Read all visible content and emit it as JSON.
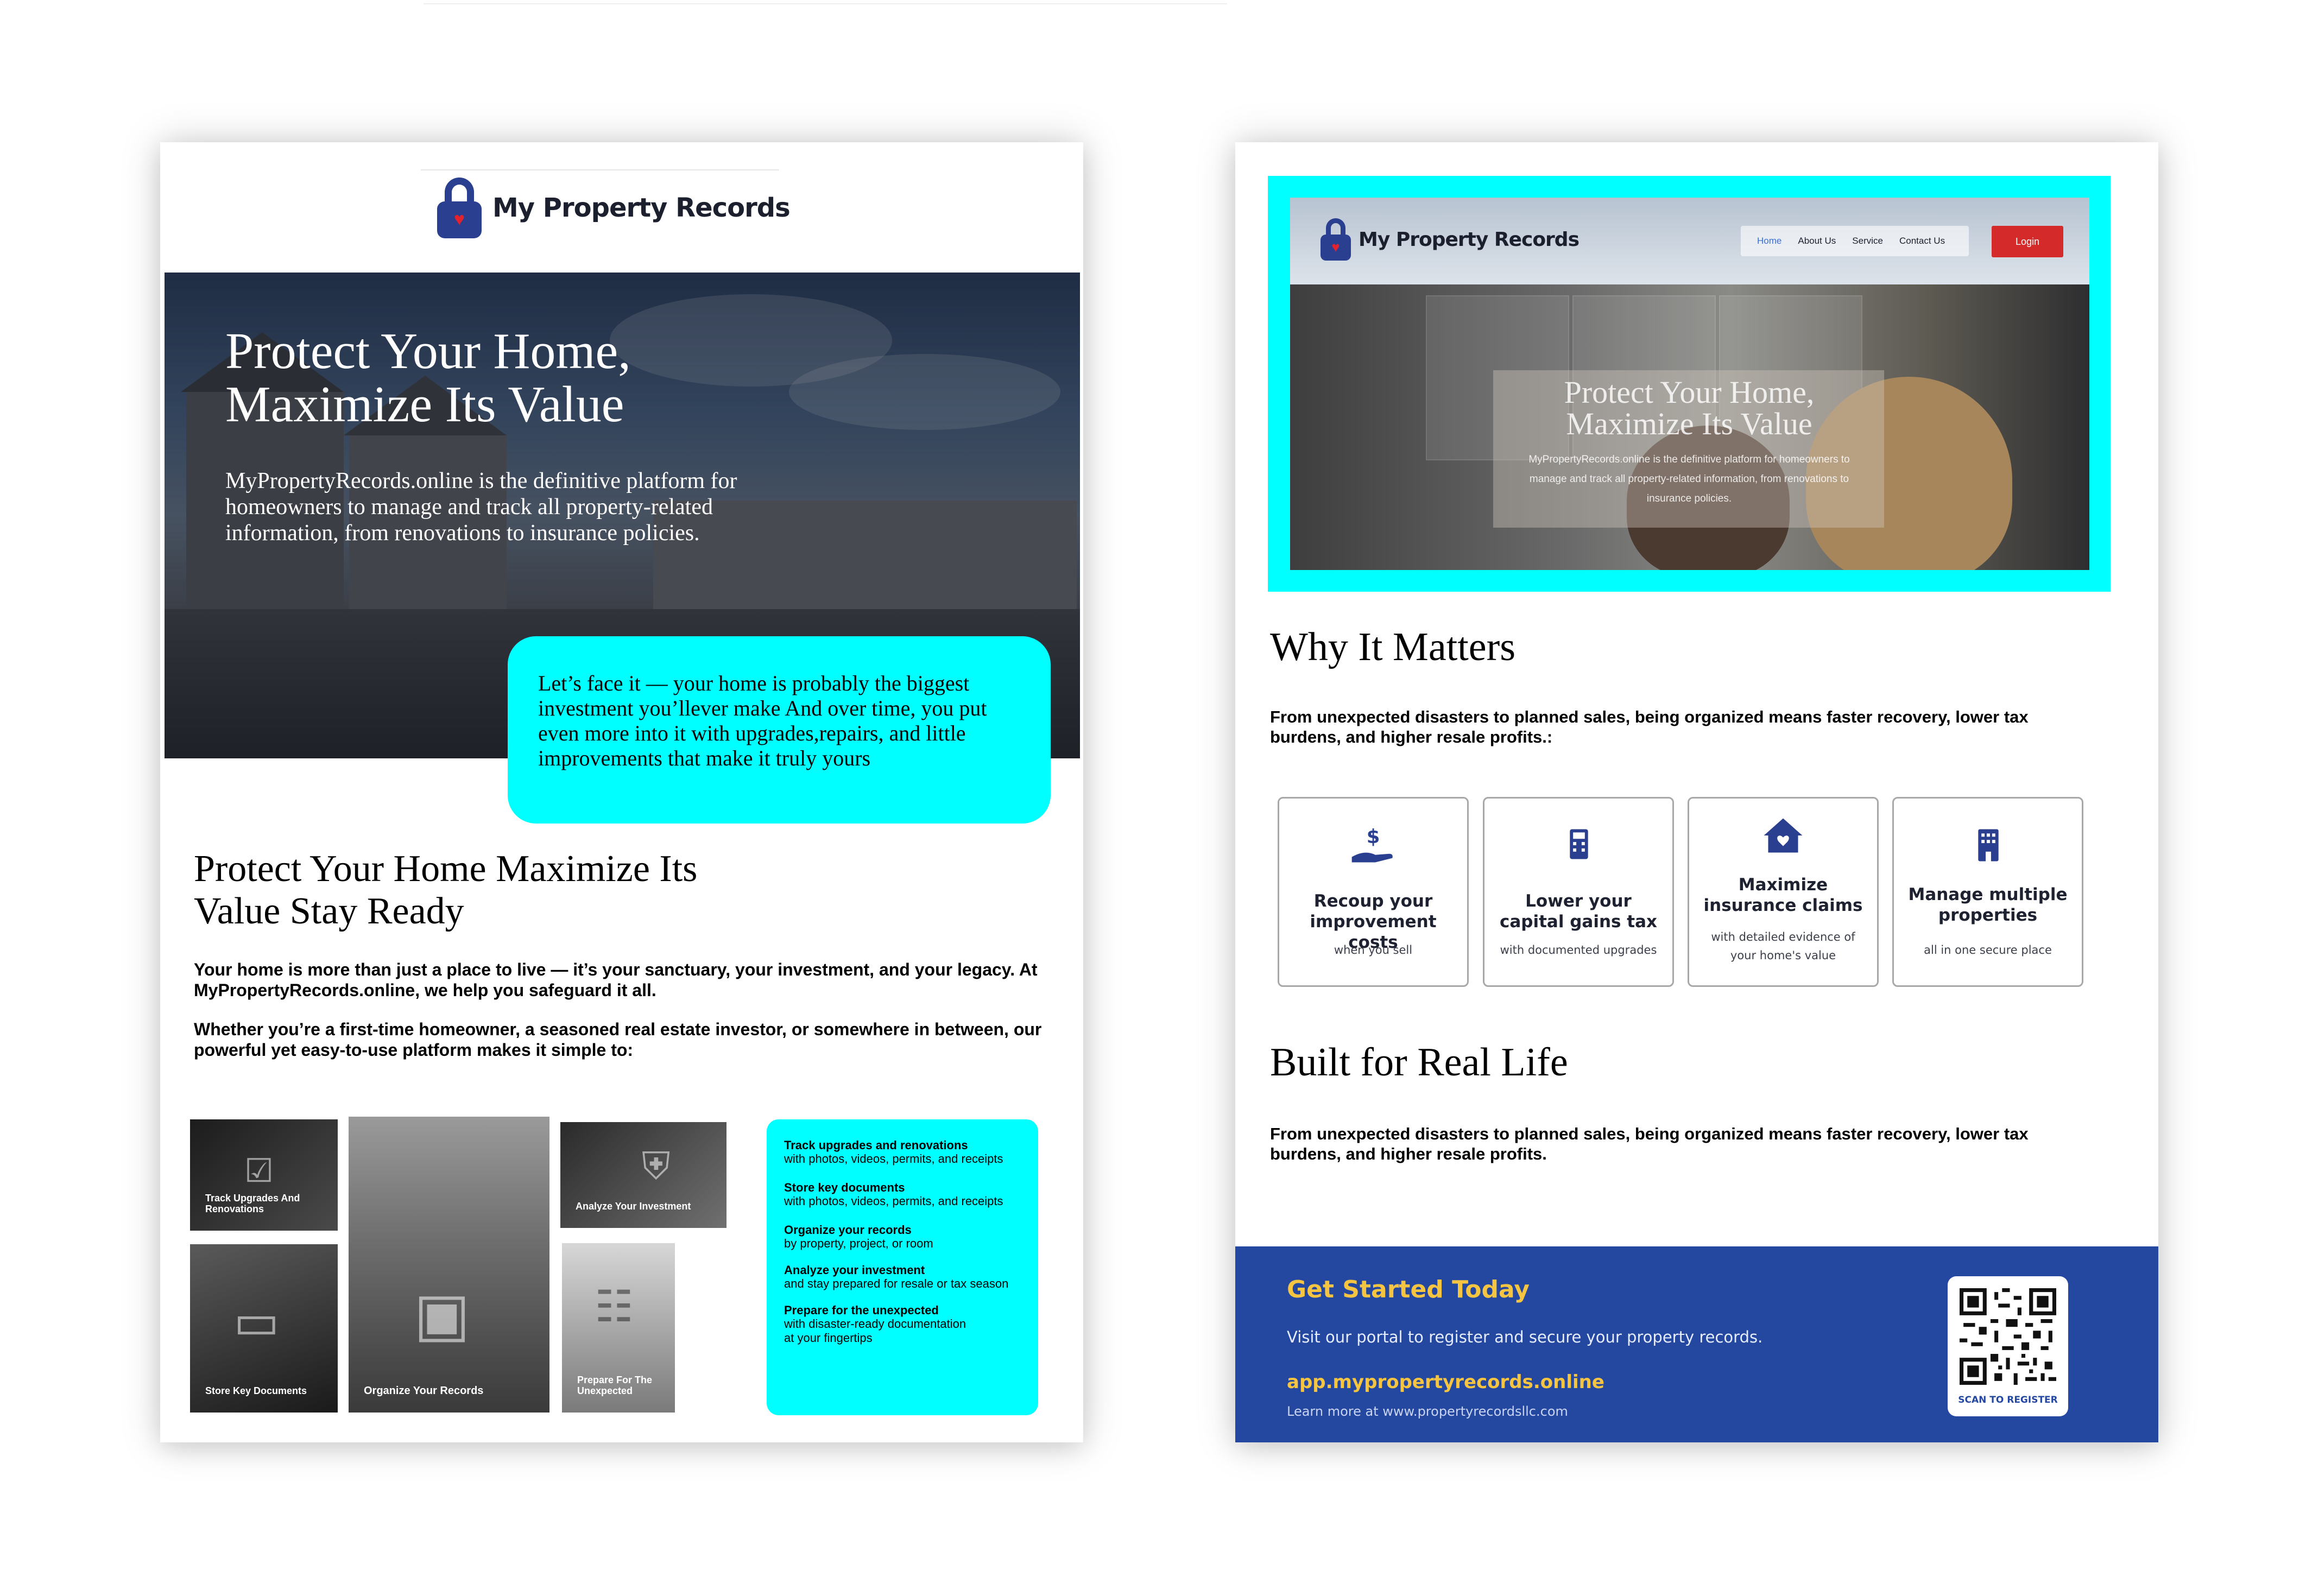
{
  "brand": {
    "name": "My Property Records"
  },
  "left": {
    "hero": {
      "title": "Protect Your Home, Maximize Its Value",
      "body": "MyPropertyRecords.online is the definitive platform for homeowners to manage and track all property-related information, from renovations to insurance policies."
    },
    "callout": "Let’s face it —  your home is probably the biggest investment you’llever make And over time, you put even more into it with upgrades,repairs, and little improvements that make it truly yours",
    "section_title": "Protect Your Home Maximize Its Value Stay Ready",
    "para1": "Your home is more than just a place to live — it’s your sanctuary, your investment, and your legacy. At MyPropertyRecords.online, we help you safeguard it all.",
    "para2": "Whether you’re a first-time homeowner, a seasoned real estate investor, or somewhere in between, our powerful yet easy-to-use platform makes it simple to:",
    "tiles": [
      {
        "label": "Track Upgrades And Renovations",
        "icon": "checklist-icon"
      },
      {
        "label": "Store Key Documents",
        "icon": "tablet-icon"
      },
      {
        "label": "Organize Your Records",
        "icon": "boxes-icon"
      },
      {
        "label": "Analyze Your Investment",
        "icon": "shield-icon"
      },
      {
        "label": "Prepare For The Unexpected",
        "icon": "ladder-icon"
      }
    ],
    "features": [
      {
        "title": "Track upgrades and renovations",
        "sub": "with photos, videos, permits, and receipts"
      },
      {
        "title": "Store key documents",
        "sub": "with photos, videos, permits, and receipts"
      },
      {
        "title": "Organize your records",
        "sub": "by property, project, or room"
      },
      {
        "title": "Analyze your investment",
        "sub": "and stay prepared for resale or tax season"
      },
      {
        "title": "Prepare for the unexpected",
        "sub": "with disaster-ready documentation at your fingertips"
      }
    ]
  },
  "right": {
    "site": {
      "nav": [
        "Home",
        "About Us",
        "Service",
        "Contact Us"
      ],
      "login": "Login",
      "hero_title": "Protect Your Home, Maximize Its Value",
      "hero_body": "MyPropertyRecords.online is the definitive platform for homeowners to manage and track all property-related information, from renovations to insurance policies."
    },
    "why": {
      "title": "Why It Matters",
      "body": "From unexpected disasters to planned sales, being organized means faster recovery, lower tax burdens, and higher resale profits.:"
    },
    "cards": [
      {
        "icon": "hand-dollar-icon",
        "title": "Recoup your improvement costs",
        "sub": "when you sell"
      },
      {
        "icon": "calculator-icon",
        "title": "Lower your capital gains tax",
        "sub": "with documented upgrades"
      },
      {
        "icon": "house-icon",
        "title": "Maximize insurance claims",
        "sub": "with detailed evidence of your home's value"
      },
      {
        "icon": "building-icon",
        "title": "Manage multiple properties",
        "sub": "all in one secure place"
      }
    ],
    "built": {
      "title": "Built for Real Life",
      "body": "From unexpected disasters to planned sales, being organized means faster recovery, lower tax burdens, and higher resale profits."
    },
    "footer": {
      "title": "Get Started Today",
      "body": "Visit our portal to register and secure your property records.",
      "link": "app.mypropertyrecords.online",
      "small": "Learn more at www.propertyrecordsllc.com",
      "qr_label": "SCAN TO REGISTER"
    }
  },
  "colors": {
    "brand_navy": "#2a3f8f",
    "cyan": "#00ffff",
    "footer_blue": "#2447a0",
    "accent_gold": "#f5c542",
    "login_red": "#d42a2a"
  }
}
